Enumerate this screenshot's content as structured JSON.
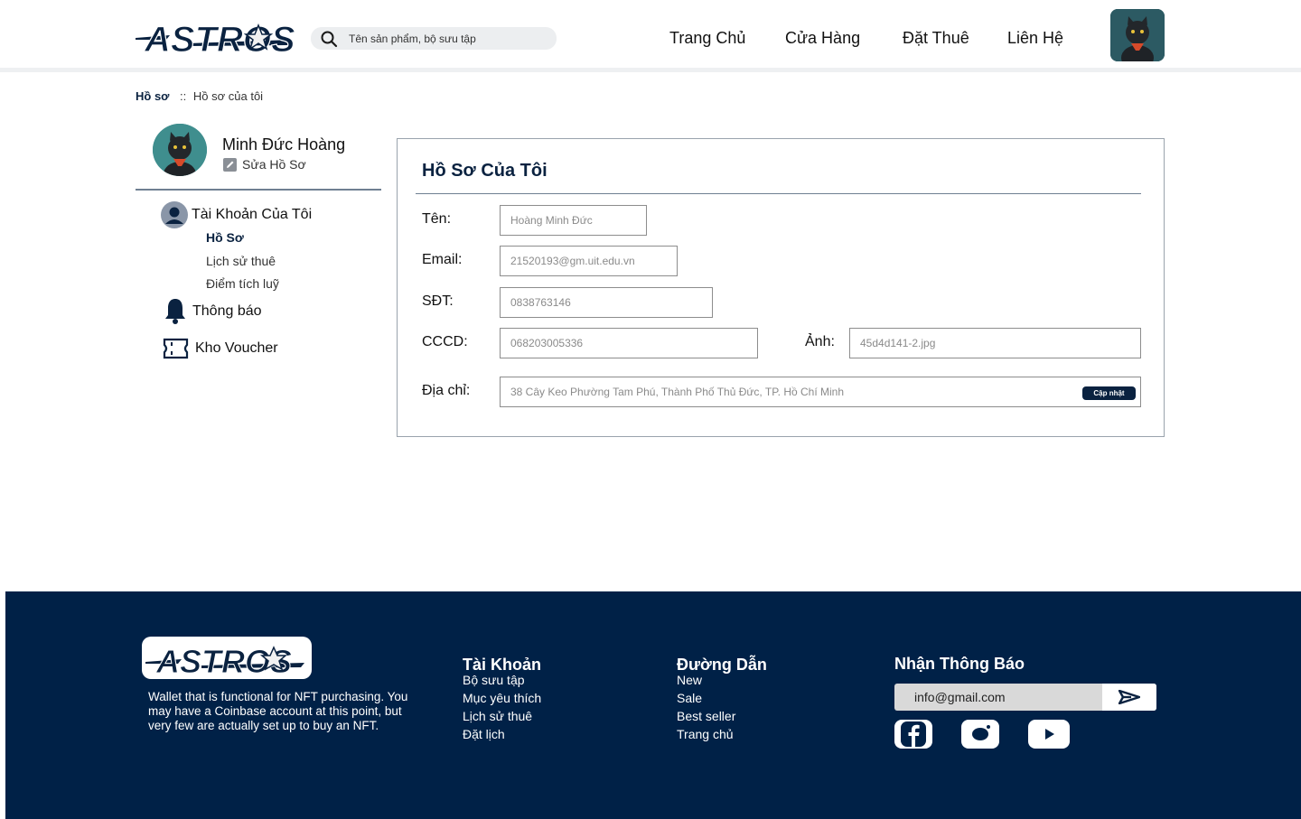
{
  "header": {
    "logo_text": "ASTROS",
    "search_placeholder": "Tên sản phẩm, bộ sưu tập",
    "nav": [
      "Trang Chủ",
      "Cửa Hàng",
      "Đặt Thuê",
      "Liên Hệ"
    ]
  },
  "breadcrumb": {
    "main": "Hồ sơ",
    "separator": "::",
    "current": "Hồ sơ của tôi"
  },
  "sidebar": {
    "user_name": "Minh Đức Hoàng",
    "edit_label": "Sửa Hồ Sơ",
    "account_label": "Tài Khoản Của Tôi",
    "account_items": [
      "Hồ Sơ",
      "Lịch sử thuê",
      "Điểm tích luỹ"
    ],
    "notifications_label": "Thông báo",
    "voucher_label": "Kho Voucher"
  },
  "profile": {
    "title": "Hồ Sơ Của Tôi",
    "fields": {
      "name": {
        "label": "Tên:",
        "value": "Hoàng Minh Đức"
      },
      "email": {
        "label": "Email:",
        "value": "21520193@gm.uit.edu.vn"
      },
      "phone": {
        "label": "SĐT:",
        "value": "0838763146"
      },
      "id_card": {
        "label": "CCCD:",
        "value": "068203005336"
      },
      "photo": {
        "label": "Ảnh:",
        "value": "45d4d141-2.jpg"
      },
      "address": {
        "label": "Địa chỉ:",
        "value": "38 Cây Keo Phường Tam Phú, Thành Phố Thủ Đức, TP. Hồ Chí Minh"
      }
    },
    "update_label": "Cập nhật"
  },
  "footer": {
    "logo_text": "ASTROS",
    "description": "Wallet that is functional for NFT purchasing. You may have a Coinbase account at this point, but very few are actually set up to buy an NFT.",
    "account_col": {
      "title": "Tài Khoản",
      "links": [
        "Bộ sưu tập",
        "Mục yêu thích",
        "Lịch sử thuê",
        "Đặt lịch"
      ]
    },
    "links_col": {
      "title": "Đường Dẫn",
      "links": [
        "New",
        "Sale",
        "Best seller",
        "Trang chủ"
      ]
    },
    "newsletter": {
      "title": "Nhận Thông Báo",
      "email_value": "info@gmail.com"
    }
  },
  "colors": {
    "brand_navy": "#002147",
    "accent_dark": "#0a2240",
    "search_bg": "#eceef0"
  }
}
